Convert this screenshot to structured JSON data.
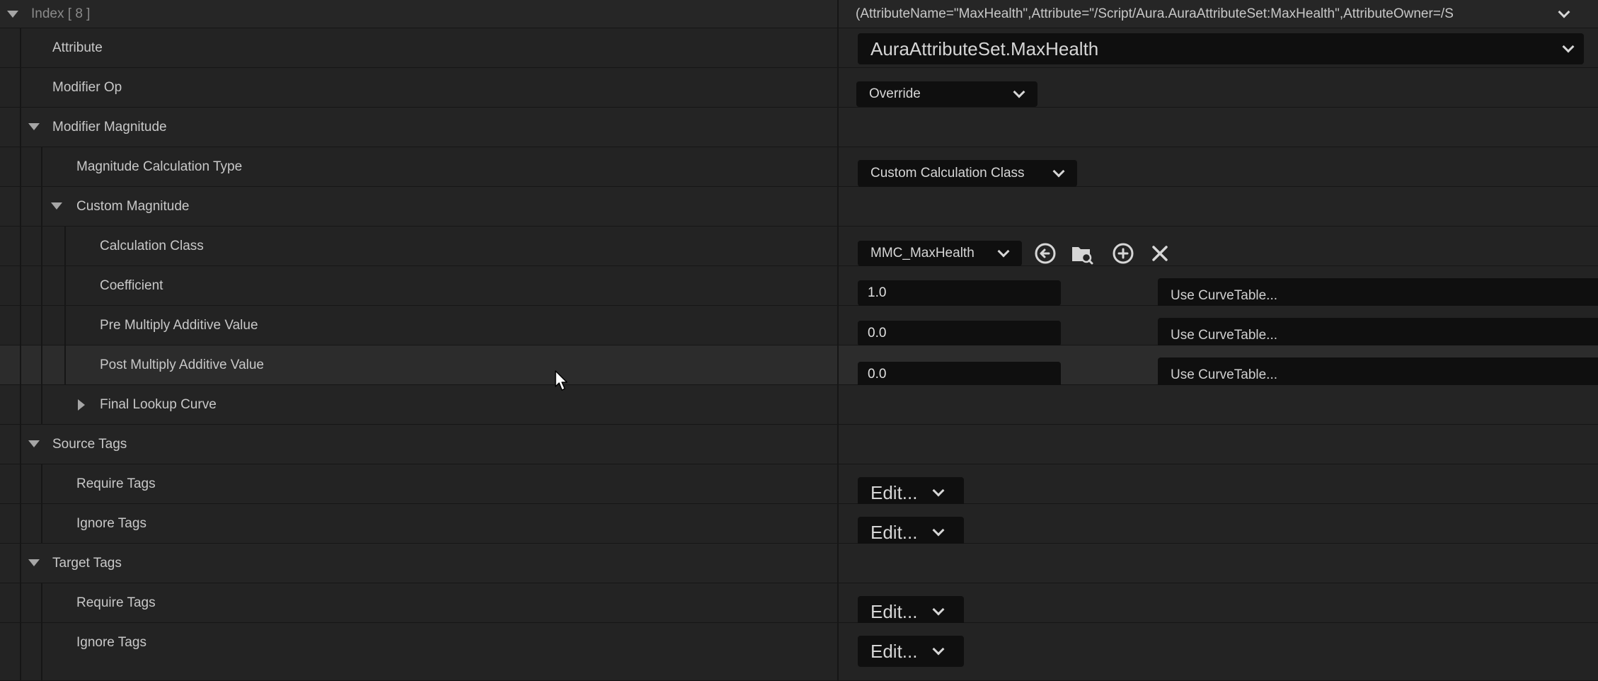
{
  "header": {
    "label": "Index [ 8 ]",
    "value": "(AttributeName=\"MaxHealth\",Attribute=\"/Script/Aura.AuraAttributeSet:MaxHealth\",AttributeOwner=/S"
  },
  "attribute": {
    "label": "Attribute",
    "value": "AuraAttributeSet.MaxHealth"
  },
  "modifier_op": {
    "label": "Modifier Op",
    "value": "Override"
  },
  "modifier_magnitude": {
    "label": "Modifier Magnitude"
  },
  "magnitude_calc_type": {
    "label": "Magnitude Calculation Type",
    "value": "Custom Calculation Class"
  },
  "custom_magnitude": {
    "label": "Custom Magnitude"
  },
  "calculation_class": {
    "label": "Calculation Class",
    "value": "MMC_MaxHealth"
  },
  "coefficient": {
    "label": "Coefficient",
    "value": "1.0",
    "curve": "Use CurveTable..."
  },
  "pre_multiply": {
    "label": "Pre Multiply Additive Value",
    "value": "0.0",
    "curve": "Use CurveTable..."
  },
  "post_multiply": {
    "label": "Post Multiply Additive Value",
    "value": "0.0",
    "curve": "Use CurveTable..."
  },
  "final_lookup": {
    "label": "Final Lookup Curve"
  },
  "source_tags": {
    "label": "Source Tags",
    "require": {
      "label": "Require Tags",
      "value": "Edit..."
    },
    "ignore": {
      "label": "Ignore Tags",
      "value": "Edit..."
    }
  },
  "target_tags": {
    "label": "Target Tags",
    "require": {
      "label": "Require Tags",
      "value": "Edit..."
    },
    "ignore": {
      "label": "Ignore Tags",
      "value": "Edit..."
    }
  },
  "icons": {
    "use_selected": "arrow-left-circle-icon",
    "browse": "folder-search-icon",
    "create": "plus-circle-icon",
    "clear": "close-icon"
  }
}
